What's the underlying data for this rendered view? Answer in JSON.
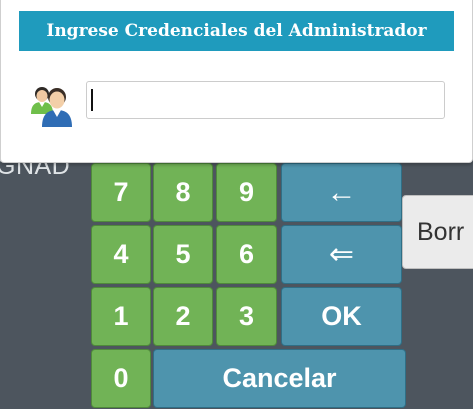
{
  "dialog": {
    "title": "Ingrese Credenciales del Administrador",
    "input_value": ""
  },
  "background": {
    "label_fragment": "GNAD",
    "borrar_label": "Borr"
  },
  "keypad": {
    "k7": "7",
    "k8": "8",
    "k9": "9",
    "k4": "4",
    "k5": "5",
    "k6": "6",
    "k1": "1",
    "k2": "2",
    "k3": "3",
    "k0": "0",
    "backspace": "←",
    "double_backspace": "⇐",
    "ok": "OK",
    "cancel": "Cancelar"
  },
  "colors": {
    "title_bar": "#1f9bbd",
    "number_key": "#71b356",
    "action_key": "#4e94ad",
    "background": "#4d555e"
  },
  "icons": {
    "user": "users-icon"
  }
}
